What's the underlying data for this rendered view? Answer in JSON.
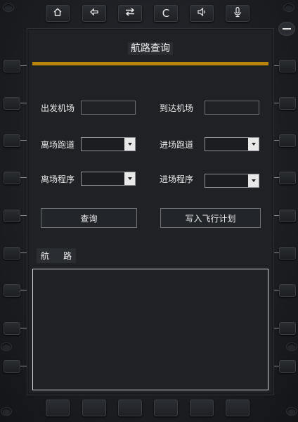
{
  "title": "航路查询",
  "top_buttons": [
    {
      "name": "home-icon",
      "glyph": "⌂"
    },
    {
      "name": "back-icon",
      "glyph": "⇦"
    },
    {
      "name": "swap-icon",
      "glyph": "⇄"
    },
    {
      "name": "clear-icon",
      "glyph": "C"
    },
    {
      "name": "volume-icon",
      "glyph": "🔈"
    },
    {
      "name": "mic-icon",
      "glyph": "🎙"
    }
  ],
  "form": {
    "departure_airport_label": "出发机场",
    "arrival_airport_label": "到达机场",
    "departure_runway_label": "离场跑道",
    "arrival_runway_label": "进场跑道",
    "departure_procedure_label": "离场程序",
    "arrival_procedure_label": "进场程序",
    "departure_airport_value": "",
    "arrival_airport_value": "",
    "departure_runway_value": "",
    "arrival_runway_value": "",
    "departure_procedure_value": "",
    "arrival_procedure_value": ""
  },
  "actions": {
    "query_label": "查询",
    "write_plan_label": "写入飞行计划"
  },
  "route": {
    "label_part1": "航",
    "label_part2": "路"
  },
  "colors": {
    "accent_bar": "#b8860b",
    "screen_bg": "#1f2125"
  }
}
